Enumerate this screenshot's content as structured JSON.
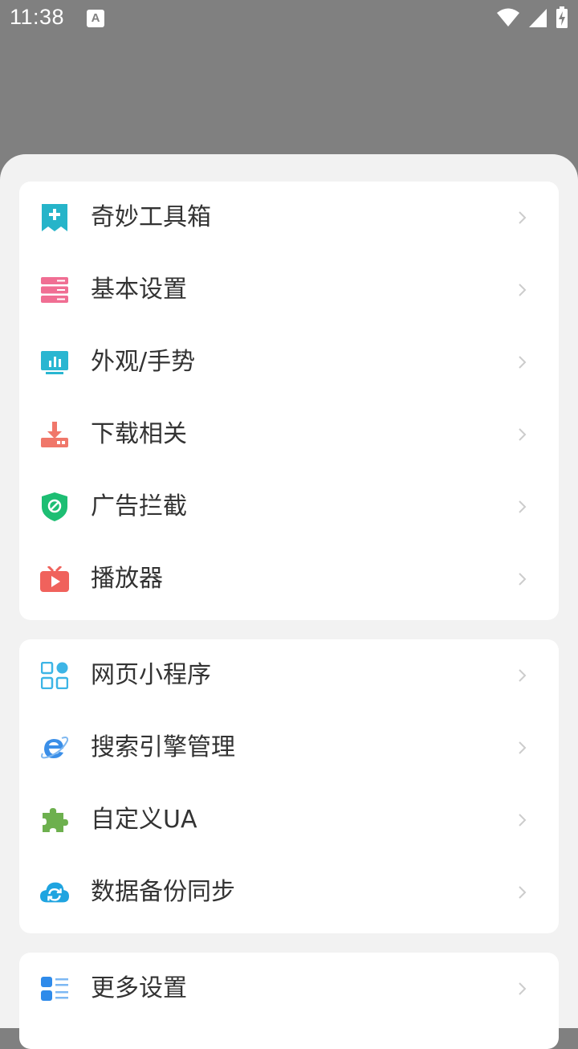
{
  "status_bar": {
    "time": "11:38",
    "notification_icon": "A",
    "icons": [
      "wifi-icon",
      "signal-icon",
      "battery-charging-icon"
    ]
  },
  "groups": [
    {
      "items": [
        {
          "label": "奇妙工具箱",
          "icon": "toolbox-icon",
          "color": "#26B4C9"
        },
        {
          "label": "基本设置",
          "icon": "settings-list-icon",
          "color": "#F06E93"
        },
        {
          "label": "外观/手势",
          "icon": "monitor-icon",
          "color": "#29B6D1"
        },
        {
          "label": "下载相关",
          "icon": "download-icon",
          "color": "#F0776A"
        },
        {
          "label": "广告拦截",
          "icon": "shield-block-icon",
          "color": "#1DBE73"
        },
        {
          "label": "播放器",
          "icon": "tv-play-icon",
          "color": "#F0625C"
        }
      ]
    },
    {
      "items": [
        {
          "label": "网页小程序",
          "icon": "mini-apps-icon",
          "color": "#3DB5E6"
        },
        {
          "label": "搜索引擎管理",
          "icon": "browser-e-icon",
          "color": "#3B8FE8"
        },
        {
          "label": "自定义UA",
          "icon": "puzzle-icon",
          "color": "#6DB04E"
        },
        {
          "label": "数据备份同步",
          "icon": "cloud-sync-icon",
          "color": "#1FA4E0"
        }
      ]
    },
    {
      "items": [
        {
          "label": "更多设置",
          "icon": "more-list-icon",
          "color": "#2F8BEA"
        }
      ]
    }
  ]
}
